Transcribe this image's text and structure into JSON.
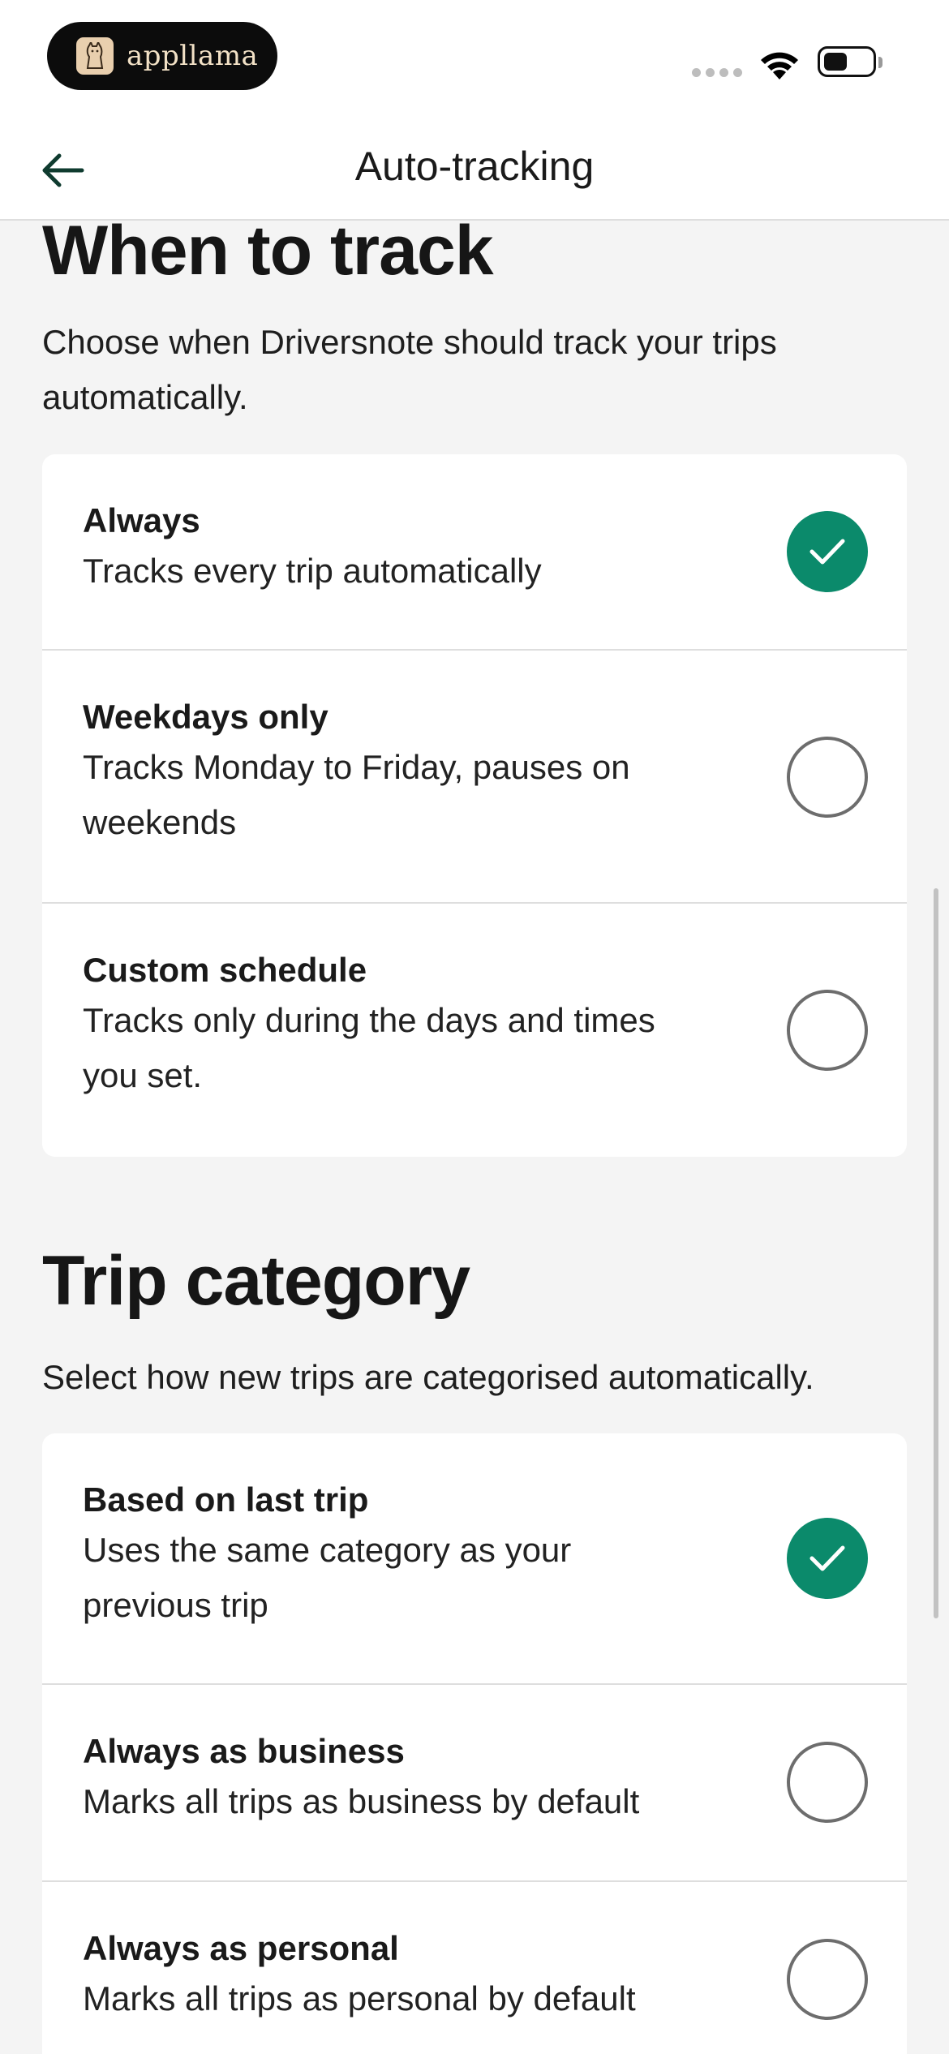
{
  "status_bar": {
    "brand_label": "appllama"
  },
  "nav": {
    "title": "Auto-tracking"
  },
  "when_to_track": {
    "heading": "When to track",
    "description": "Choose when Driversnote should track your trips automatically.",
    "options": [
      {
        "title": "Always",
        "subtitle": "Tracks every trip automatically",
        "selected": true
      },
      {
        "title": "Weekdays only",
        "subtitle": "Tracks Monday to Friday, pauses on weekends",
        "selected": false
      },
      {
        "title": "Custom schedule",
        "subtitle": "Tracks only during the days and times you set.",
        "selected": false
      }
    ]
  },
  "trip_category": {
    "heading": "Trip category",
    "description": "Select how new trips are categorised automatically.",
    "options": [
      {
        "title": "Based on last trip",
        "subtitle": "Uses the same category as your previous trip",
        "selected": true
      },
      {
        "title": "Always as business",
        "subtitle": "Marks all trips as business by default",
        "selected": false
      },
      {
        "title": "Always as personal",
        "subtitle": "Marks all trips as personal by default",
        "selected": false
      }
    ]
  },
  "colors": {
    "accent": "#0b8a6b",
    "background": "#f4f4f4",
    "card": "#ffffff"
  }
}
